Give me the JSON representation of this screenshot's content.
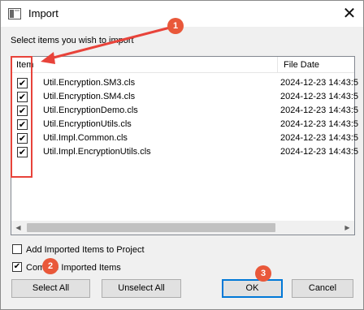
{
  "window": {
    "title": "Import",
    "close_glyph": "✕",
    "icon": "app-window-icon"
  },
  "prompt": "Select items you wish to import",
  "list": {
    "columns": [
      "Item",
      "File Date"
    ],
    "rows": [
      {
        "name": "Util.Encryption.SM3.cls",
        "date": "2024-12-23 14:43:5",
        "checked": true
      },
      {
        "name": "Util.Encryption.SM4.cls",
        "date": "2024-12-23 14:43:5",
        "checked": true
      },
      {
        "name": "Util.EncryptionDemo.cls",
        "date": "2024-12-23 14:43:5",
        "checked": true
      },
      {
        "name": "Util.EncryptionUtils.cls",
        "date": "2024-12-23 14:43:5",
        "checked": true
      },
      {
        "name": "Util.Impl.Common.cls",
        "date": "2024-12-23 14:43:5",
        "checked": true
      },
      {
        "name": "Util.Impl.EncryptionUtils.cls",
        "date": "2024-12-23 14:43:5",
        "checked": true
      }
    ],
    "scroll_left_glyph": "◀",
    "scroll_right_glyph": "▶"
  },
  "options": {
    "add_to_project": {
      "label": "Add Imported Items to Project",
      "checked": false
    },
    "compile": {
      "label": "Compile Imported Items",
      "checked": true
    }
  },
  "buttons": {
    "select_all": "Select All",
    "unselect_all": "Unselect All",
    "ok": "OK",
    "cancel": "Cancel"
  },
  "check_glyph": "✔",
  "annotations": {
    "badge_1": "1",
    "badge_2": "2",
    "badge_3": "3",
    "color": "#e8433a"
  }
}
